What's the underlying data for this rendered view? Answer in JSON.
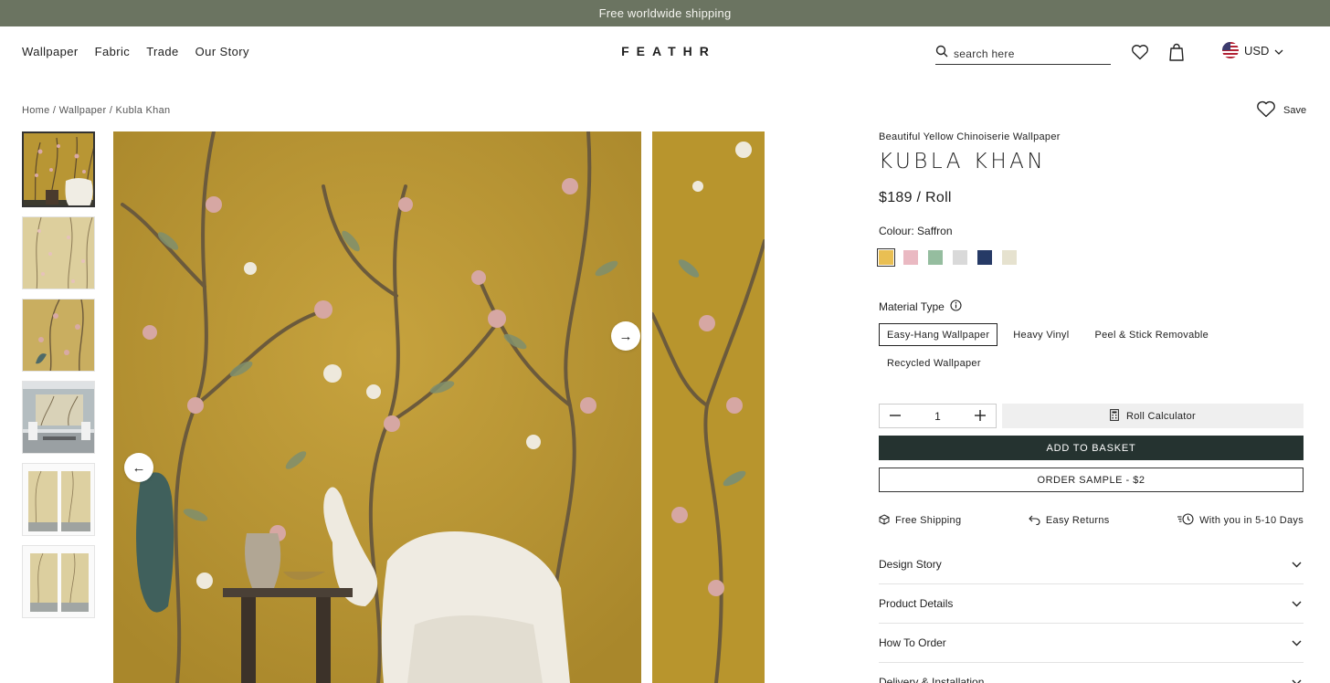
{
  "announcement": "Free worldwide shipping",
  "nav": {
    "links": [
      "Wallpaper",
      "Fabric",
      "Trade",
      "Our Story"
    ],
    "logo": "FEATHR",
    "search_placeholder": "search here",
    "currency": "USD"
  },
  "breadcrumb": {
    "home": "Home",
    "category": "Wallpaper",
    "current": "Kubla Khan",
    "sep": "/"
  },
  "product": {
    "save_label": "Save",
    "subtitle": "Beautiful Yellow Chinoiserie Wallpaper",
    "title": "KUBLA KHAN",
    "price": "$189 / Roll",
    "colour_label": "Colour: Saffron",
    "swatches": [
      {
        "name": "Saffron",
        "color": "#e9bf53",
        "selected": true
      },
      {
        "name": "Pink",
        "color": "#eab9c2",
        "selected": false
      },
      {
        "name": "Green",
        "color": "#95bd9f",
        "selected": false
      },
      {
        "name": "Grey",
        "color": "#d9d9d9",
        "selected": false
      },
      {
        "name": "Navy",
        "color": "#263a66",
        "selected": false
      },
      {
        "name": "Cream",
        "color": "#e6e2cf",
        "selected": false
      }
    ],
    "material_label": "Material Type",
    "materials": [
      "Easy-Hang Wallpaper",
      "Heavy Vinyl",
      "Peel & Stick Removable",
      "Recycled Wallpaper"
    ],
    "selected_material": "Easy-Hang Wallpaper",
    "quantity": "1",
    "roll_calculator": "Roll Calculator",
    "add_to_basket": "ADD TO BASKET",
    "order_sample": "ORDER SAMPLE - $2",
    "perks": [
      "Free Shipping",
      "Easy Returns",
      "With you in 5-10 Days"
    ],
    "accordion": [
      "Design Story",
      "Product Details",
      "How To Order",
      "Delivery & Installation"
    ]
  },
  "gallery": {
    "prev_arrow": "←",
    "next_arrow": "→"
  },
  "colors": {
    "announcement_bg": "#6b7461",
    "basket_bg": "#253330",
    "wallpaper_gold": "#b8952d"
  }
}
